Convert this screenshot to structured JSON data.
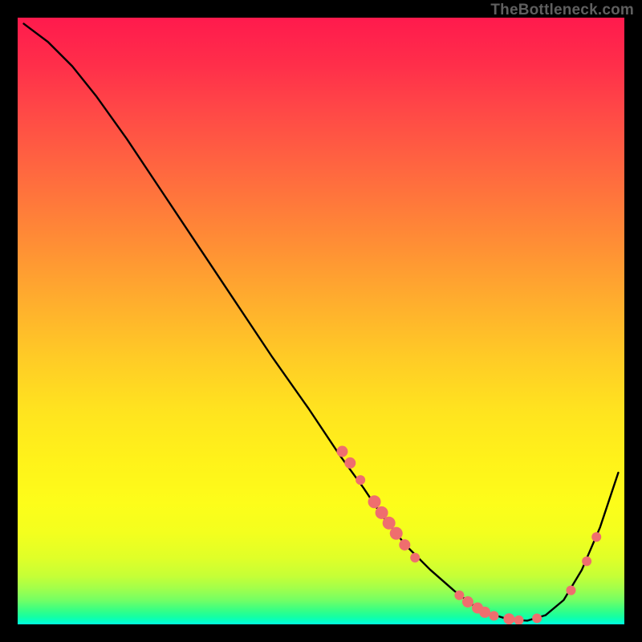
{
  "watermark": "TheBottleneck.com",
  "colors": {
    "background": "#000000",
    "curve": "#000000",
    "marker": "#ef6e6e"
  },
  "chart_data": {
    "type": "line",
    "title": "",
    "xlabel": "",
    "ylabel": "",
    "xlim": [
      0,
      100
    ],
    "ylim": [
      0,
      100
    ],
    "curve": {
      "x": [
        1,
        5,
        9,
        13,
        18,
        24,
        30,
        36,
        42,
        48,
        53,
        57,
        60,
        64,
        68,
        72,
        75,
        78,
        81,
        84,
        87,
        90,
        93,
        96,
        99
      ],
      "y": [
        99,
        96,
        92,
        87,
        80,
        71,
        62,
        53,
        44,
        35.5,
        28,
        22.5,
        18,
        13,
        9,
        5.5,
        3.2,
        1.7,
        0.8,
        0.6,
        1.5,
        4,
        9,
        16,
        25
      ]
    },
    "markers": [
      {
        "x": 53.5,
        "y": 28.5,
        "r": 7
      },
      {
        "x": 54.8,
        "y": 26.6,
        "r": 7
      },
      {
        "x": 56.5,
        "y": 23.8,
        "r": 6
      },
      {
        "x": 58.8,
        "y": 20.2,
        "r": 8
      },
      {
        "x": 60.0,
        "y": 18.4,
        "r": 8
      },
      {
        "x": 61.2,
        "y": 16.7,
        "r": 8
      },
      {
        "x": 62.4,
        "y": 15.0,
        "r": 8
      },
      {
        "x": 63.8,
        "y": 13.1,
        "r": 7
      },
      {
        "x": 65.5,
        "y": 11.0,
        "r": 6
      },
      {
        "x": 72.8,
        "y": 4.8,
        "r": 6
      },
      {
        "x": 74.2,
        "y": 3.7,
        "r": 7
      },
      {
        "x": 75.8,
        "y": 2.7,
        "r": 7
      },
      {
        "x": 77.0,
        "y": 2.0,
        "r": 7
      },
      {
        "x": 78.5,
        "y": 1.4,
        "r": 6
      },
      {
        "x": 81.0,
        "y": 0.9,
        "r": 7
      },
      {
        "x": 82.6,
        "y": 0.7,
        "r": 6
      },
      {
        "x": 85.6,
        "y": 1.0,
        "r": 6
      },
      {
        "x": 91.2,
        "y": 5.6,
        "r": 6
      },
      {
        "x": 93.8,
        "y": 10.4,
        "r": 6
      },
      {
        "x": 95.4,
        "y": 14.4,
        "r": 6
      }
    ]
  }
}
